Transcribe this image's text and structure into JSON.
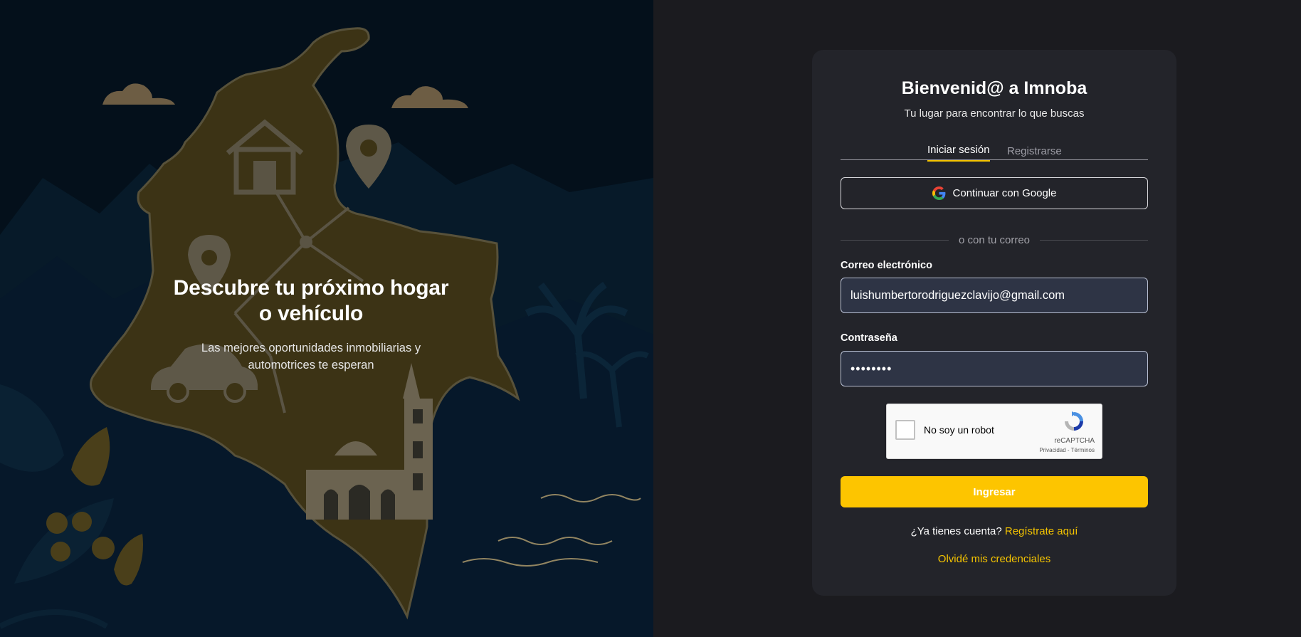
{
  "hero": {
    "title_line1": "Descubre tu próximo hogar",
    "title_line2": "o vehículo",
    "subtitle_line1": "Las mejores oportunidades inmobiliarias y",
    "subtitle_line2": "automotrices te esperan"
  },
  "card": {
    "title": "Bienvenid@ a Imnoba",
    "subtitle": "Tu lugar para encontrar lo que buscas"
  },
  "tabs": {
    "login": "Iniciar sesión",
    "register": "Registrarse",
    "active": "login"
  },
  "google": {
    "label": "Continuar con Google",
    "icon": "google-icon"
  },
  "divider": "o con tu correo",
  "form": {
    "email_label": "Correo electrónico",
    "email_value": "luishumbertorodriguezclavijo@gmail.com",
    "password_label": "Contraseña",
    "password_value": "••••••••"
  },
  "captcha": {
    "label": "No soy un robot",
    "brand": "reCAPTCHA",
    "links": "Privacidad - Términos"
  },
  "submit_label": "Ingresar",
  "footer": {
    "account_text": "¿Ya tienes cuenta?",
    "account_link": "Regístrate aquí",
    "forgot": "Olvidé mis credenciales"
  },
  "colors": {
    "accent": "#fdc500",
    "card_bg": "#23242a",
    "page_bg": "#1b1b1f",
    "hero_bg": "#04101b",
    "input_bg": "#2e3445"
  }
}
